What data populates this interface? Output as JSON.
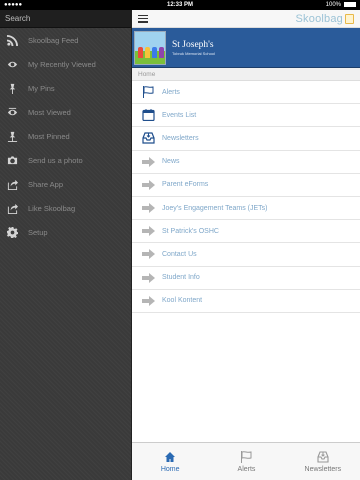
{
  "status_bar": {
    "time": "12:33 PM",
    "battery": "100%"
  },
  "sidebar": {
    "search_label": "Search",
    "items": [
      {
        "label": "Skoolbag Feed",
        "icon": "rss-icon"
      },
      {
        "label": "My Recently Viewed",
        "icon": "eye-icon"
      },
      {
        "label": "My Pins",
        "icon": "pin-icon"
      },
      {
        "label": "Most Viewed",
        "icon": "eye-icon"
      },
      {
        "label": "Most Pinned",
        "icon": "pin-icon"
      },
      {
        "label": "Send us a photo",
        "icon": "camera-icon"
      },
      {
        "label": "Share App",
        "icon": "share-icon"
      },
      {
        "label": "Like Skoolbag",
        "icon": "share-icon"
      },
      {
        "label": "Setup",
        "icon": "gear-icon"
      }
    ]
  },
  "header": {
    "brand": "Skoolbag"
  },
  "banner": {
    "school_name": "St Joseph's",
    "school_sub": "Tobruk Memorial School"
  },
  "breadcrumb": "Home",
  "menu": [
    {
      "label": "Alerts",
      "icon": "flag-icon"
    },
    {
      "label": "Events List",
      "icon": "calendar-icon"
    },
    {
      "label": "Newsletters",
      "icon": "inbox-icon"
    },
    {
      "label": "News",
      "icon": "arrow-right-icon"
    },
    {
      "label": "Parent eForms",
      "icon": "arrow-right-icon"
    },
    {
      "label": "Joey's Engagement Teams (JETs)",
      "icon": "arrow-right-icon"
    },
    {
      "label": "St Patrick's OSHC",
      "icon": "arrow-right-icon"
    },
    {
      "label": "Contact Us",
      "icon": "arrow-right-icon"
    },
    {
      "label": "Student Info",
      "icon": "arrow-right-icon"
    },
    {
      "label": "Kool Kontent",
      "icon": "arrow-right-icon"
    }
  ],
  "tabs": [
    {
      "label": "Home",
      "icon": "home-icon",
      "active": true
    },
    {
      "label": "Alerts",
      "icon": "flag-icon",
      "active": false
    },
    {
      "label": "Newsletters",
      "icon": "inbox-icon",
      "active": false
    }
  ],
  "colors": {
    "accent": "#2a6ab3",
    "link": "#7fa7c9",
    "banner": "#2a5b9a",
    "sidebar": "#3a3a3a"
  }
}
